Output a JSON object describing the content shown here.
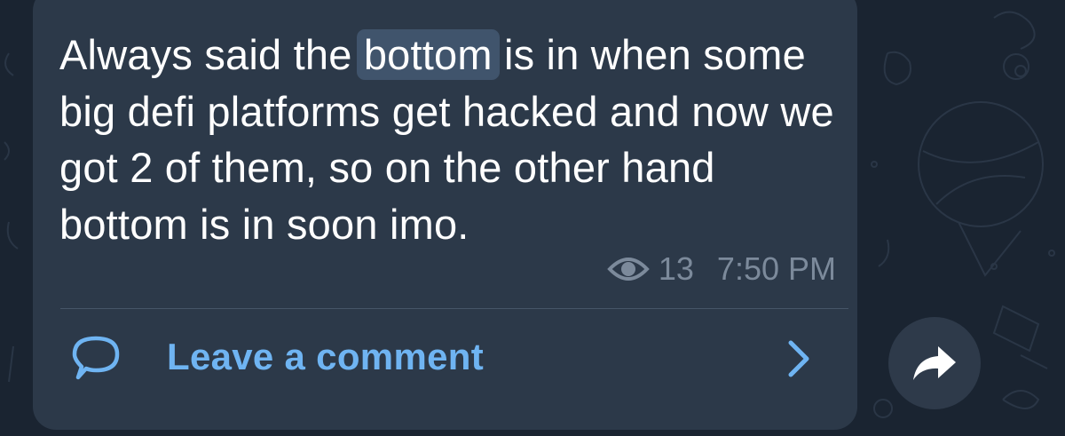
{
  "message": {
    "text_before": "Always said the ",
    "highlight": "bottom",
    "text_after": " is in when some big defi platforms get hacked and now we got 2 of them, so on the other hand bottom is in soon imo.",
    "views": "13",
    "time": "7:50 PM"
  },
  "comments": {
    "label": "Leave a comment"
  },
  "icons": {
    "views": "eye-icon",
    "comment": "comment-bubble-icon",
    "open": "chevron-right-icon",
    "share": "share-arrow-icon"
  },
  "colors": {
    "background": "#1a2431",
    "bubble": "#2c3949",
    "highlight": "#40546c",
    "link": "#6fb4f2",
    "meta": "#7c8a9b"
  }
}
